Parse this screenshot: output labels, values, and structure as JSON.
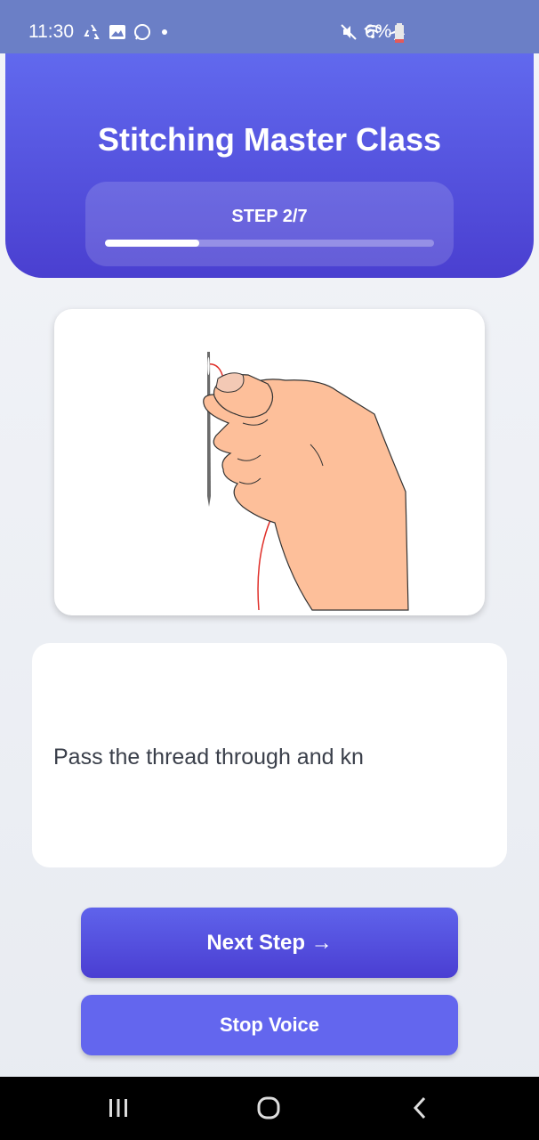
{
  "status_bar": {
    "time": "11:30",
    "battery_percent": "6%",
    "icons_left": [
      "recycle-icon",
      "gallery-icon",
      "whatsapp-icon",
      "dot-icon"
    ],
    "icons_right": [
      "mute-icon",
      "wifi-icon",
      "airplane-icon",
      "battery-icon"
    ]
  },
  "header": {
    "title": "Stitching Master Class",
    "step_label": "STEP 2/7",
    "progress": 0.286
  },
  "illustration": {
    "description_icon": "hand-threading-needle-illustration",
    "thread_color": "#e0302a",
    "skin_color": "#fdbf9a"
  },
  "instruction": {
    "text": "Pass the thread through and kn"
  },
  "buttons": {
    "next": "Next Step →",
    "stop": "Stop Voice"
  },
  "nav": {
    "items": [
      "recent-apps-icon",
      "home-icon",
      "back-icon"
    ]
  },
  "colors": {
    "accent": "#5a5fe8",
    "accent_dark": "#4a3ed2",
    "status_bar": "#6b7fc6"
  }
}
